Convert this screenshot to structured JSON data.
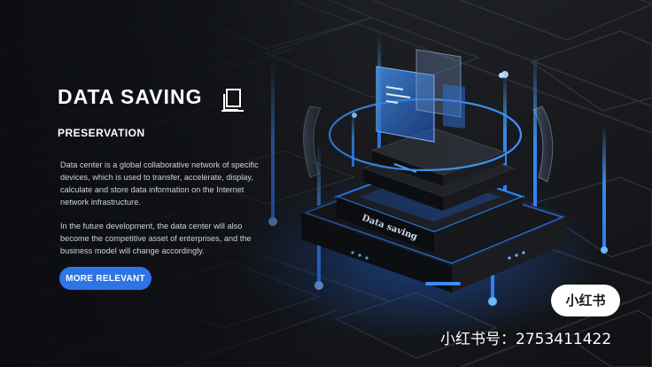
{
  "slide": {
    "title": "DATA SAVING",
    "title_icon": "document-copy-icon",
    "subtitle": "PRESERVATION",
    "paragraph_1": "Data center is a global collaborative network of specific devices, which is used to transfer, accelerate, display, calculate and store data information on the Internet network infrastructure.",
    "paragraph_2": "In the future development, the data center will also become the competitive asset of enterprises, and the business model will change accordingly.",
    "cta_label": "MORE RELEVANT",
    "device_label": "Data saving"
  },
  "watermark": {
    "badge": "小红书",
    "id_text": "小红书号：2753411422"
  },
  "colors": {
    "accent": "#2f74e6",
    "glow": "#2a8cff",
    "background": "#121417"
  }
}
